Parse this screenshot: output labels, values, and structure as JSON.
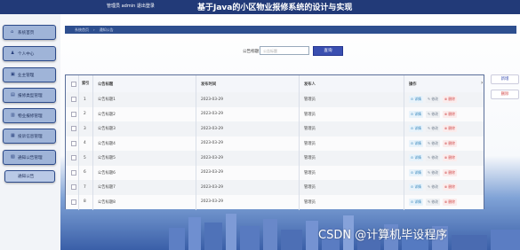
{
  "header": {
    "admin_text": "管理员 admin   退出登录",
    "title": "基于Java的小区物业报修系统的设计与实现"
  },
  "sidebar": {
    "items": [
      {
        "label": "系统首页",
        "icon": "home-icon",
        "glyph": "⌂"
      },
      {
        "label": "个人中心",
        "icon": "user-icon",
        "glyph": "♟"
      },
      {
        "label": "业主管理",
        "icon": "owner-icon",
        "glyph": "▣"
      },
      {
        "label": "报修类型管理",
        "icon": "repair-type-icon",
        "glyph": "▤"
      },
      {
        "label": "物业报修管理",
        "icon": "wrench-icon",
        "glyph": "▥"
      },
      {
        "label": "投诉信息管理",
        "icon": "complaint-icon",
        "glyph": "▦"
      },
      {
        "label": "通知公告管理",
        "icon": "notice-icon",
        "glyph": "▧"
      }
    ],
    "sub_item": {
      "label": "通知公告"
    }
  },
  "breadcrumb": {
    "home": "系统首页",
    "current": "通知公告"
  },
  "search": {
    "label": "公告标题",
    "placeholder": "公告标题",
    "button": "查询"
  },
  "table": {
    "headers": {
      "index": "索引",
      "title": "公告标题",
      "date": "发布时间",
      "publisher": "发布人",
      "actions": "操作"
    },
    "rows": [
      {
        "index": "1",
        "title": "公告标题1",
        "date": "2023-03-29",
        "publisher": "管理员"
      },
      {
        "index": "2",
        "title": "公告标题2",
        "date": "2023-03-29",
        "publisher": "管理员"
      },
      {
        "index": "3",
        "title": "公告标题3",
        "date": "2023-03-29",
        "publisher": "管理员"
      },
      {
        "index": "4",
        "title": "公告标题4",
        "date": "2023-03-29",
        "publisher": "管理员"
      },
      {
        "index": "5",
        "title": "公告标题5",
        "date": "2023-03-29",
        "publisher": "管理员"
      },
      {
        "index": "6",
        "title": "公告标题6",
        "date": "2023-03-29",
        "publisher": "管理员"
      },
      {
        "index": "7",
        "title": "公告标题7",
        "date": "2023-03-29",
        "publisher": "管理员"
      },
      {
        "index": "8",
        "title": "公告标题8",
        "date": "2023-03-29",
        "publisher": "管理员"
      }
    ],
    "actions": {
      "detail": "详情",
      "edit": "修改",
      "delete": "删除"
    }
  },
  "right_buttons": {
    "add": "新增",
    "delete": "删除"
  },
  "watermark": "CSDN @计算机毕设程序",
  "colors": {
    "header": "#223a78",
    "search_button": "#3a4fb0",
    "delete": "#d24a4a",
    "detail": "#2a7fb8"
  }
}
